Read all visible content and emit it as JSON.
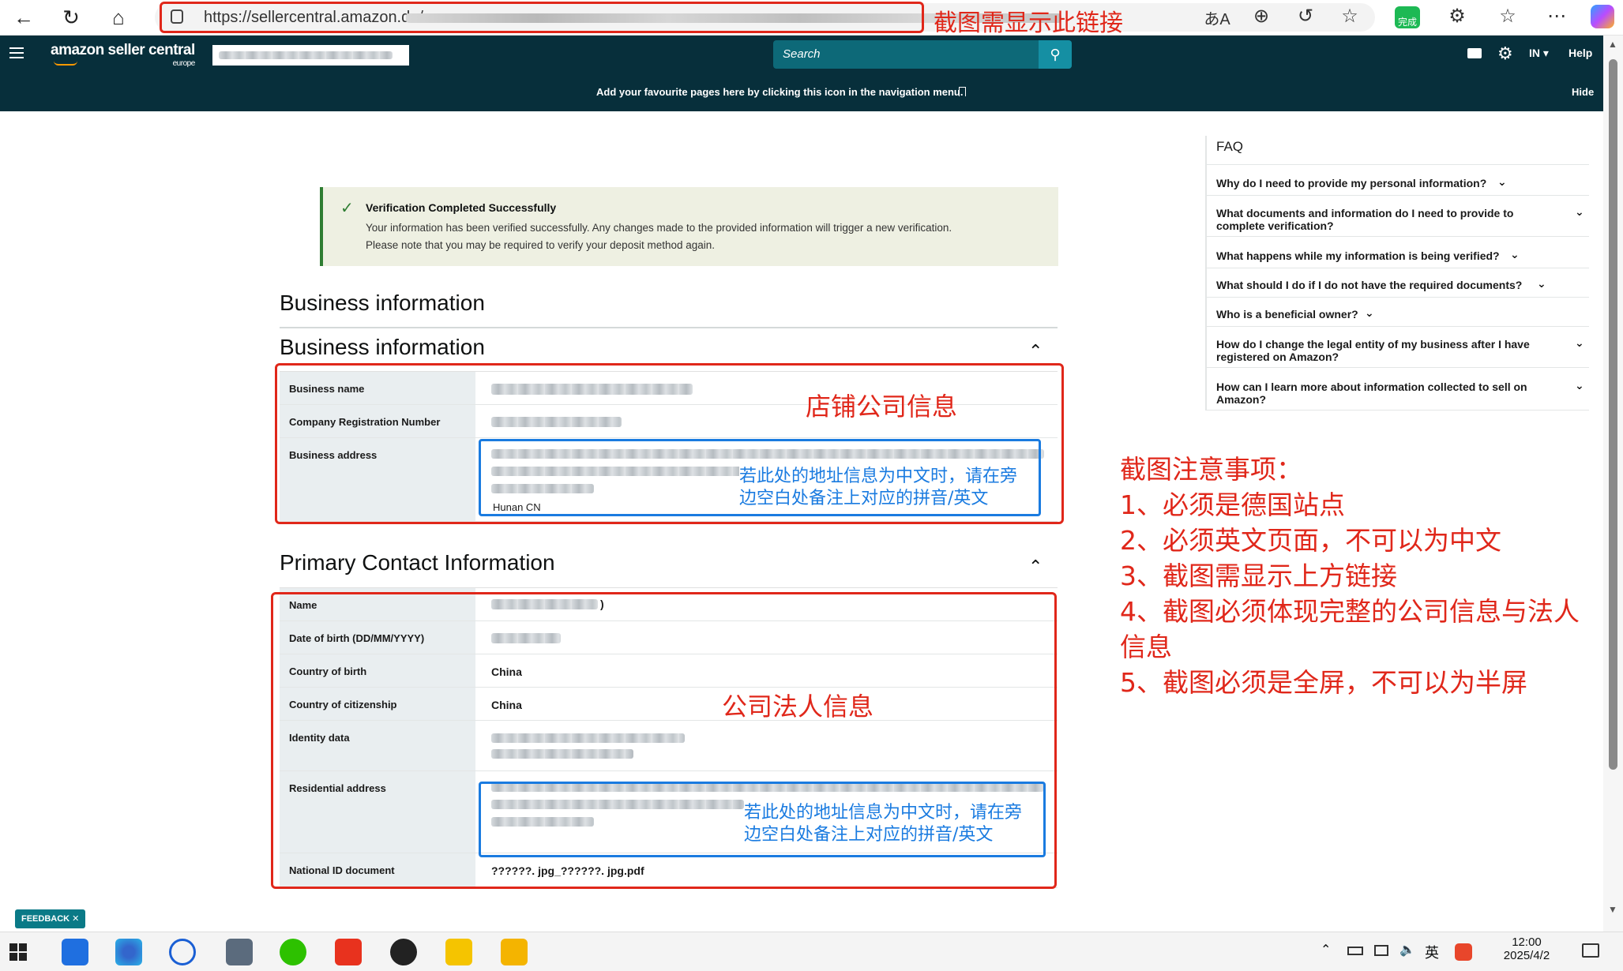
{
  "browser": {
    "url_prefix": "https://sellercentral.amazon.de/",
    "url_annotation": "截图需显示此链接",
    "translate_icon": "あA",
    "complete_badge": "完成"
  },
  "header": {
    "logo_text": "amazon seller central",
    "logo_sub": "europe",
    "search_placeholder": "Search",
    "lang": "IN",
    "help": "Help"
  },
  "favbar": {
    "message": "Add your favourite pages here by clicking this icon in the navigation menu.",
    "hide": "Hide"
  },
  "success": {
    "title": "Verification Completed Successfully",
    "line1": "Your information has been verified successfully. Any changes made to the provided information will trigger a new verification.",
    "line2": "Please note that you may be required to verify your deposit method again."
  },
  "business": {
    "page_title": "Business information",
    "section_title": "Business information",
    "rows": {
      "name_label": "Business name",
      "crn_label": "Company Registration Number",
      "address_label": "Business address",
      "address_tail": "Hunan CN"
    },
    "annotation": "店铺公司信息",
    "blue_note_1": "若此处的地址信息为中文时，请在旁",
    "blue_note_2": "边空白处备注上对应的拼音/英文"
  },
  "contact": {
    "section_title": "Primary Contact Information",
    "rows": {
      "name_label": "Name",
      "name_suffix": ")",
      "dob_label": "Date of birth (DD/MM/YYYY)",
      "cob_label": "Country of birth",
      "cob_value": "China",
      "coc_label": "Country of citizenship",
      "coc_value": "China",
      "id_label": "Identity data",
      "res_label": "Residential address",
      "nid_label": "National ID document",
      "nid_value": "??????. jpg_??????. jpg.pdf"
    },
    "annotation": "公司法人信息",
    "blue_note_1": "若此处的地址信息为中文时，请在旁",
    "blue_note_2": "边空白处备注上对应的拼音/英文"
  },
  "faq": {
    "title": "FAQ",
    "items": [
      "Why do I need to provide my personal information?",
      "What documents and information do I need to provide to complete verification?",
      "What happens while my information is being verified?",
      "What should I do if I do not have the required documents?",
      "Who is a beneficial owner?",
      "How do I change the legal entity of my business after I have registered on Amazon?",
      "How can I learn more about information collected to sell on Amazon?"
    ]
  },
  "notes": {
    "title": "截图注意事项：",
    "items": [
      "1、必须是德国站点",
      "2、必须英文页面，不可以为中文",
      "3、截图需显示上方链接",
      "4、截图必须体现完整的公司信息与法人",
      "信息",
      "5、截图必须是全屏，不可以为半屏"
    ]
  },
  "feedback": "FEEDBACK ✕",
  "taskbar": {
    "ime": "英",
    "time": "12:00",
    "date": "2025/4/2"
  },
  "colors": {
    "nav_bg": "#072f3b",
    "annotation_red": "#e0271a",
    "annotation_blue": "#1a7be0",
    "success_bg": "#eef0e2"
  }
}
